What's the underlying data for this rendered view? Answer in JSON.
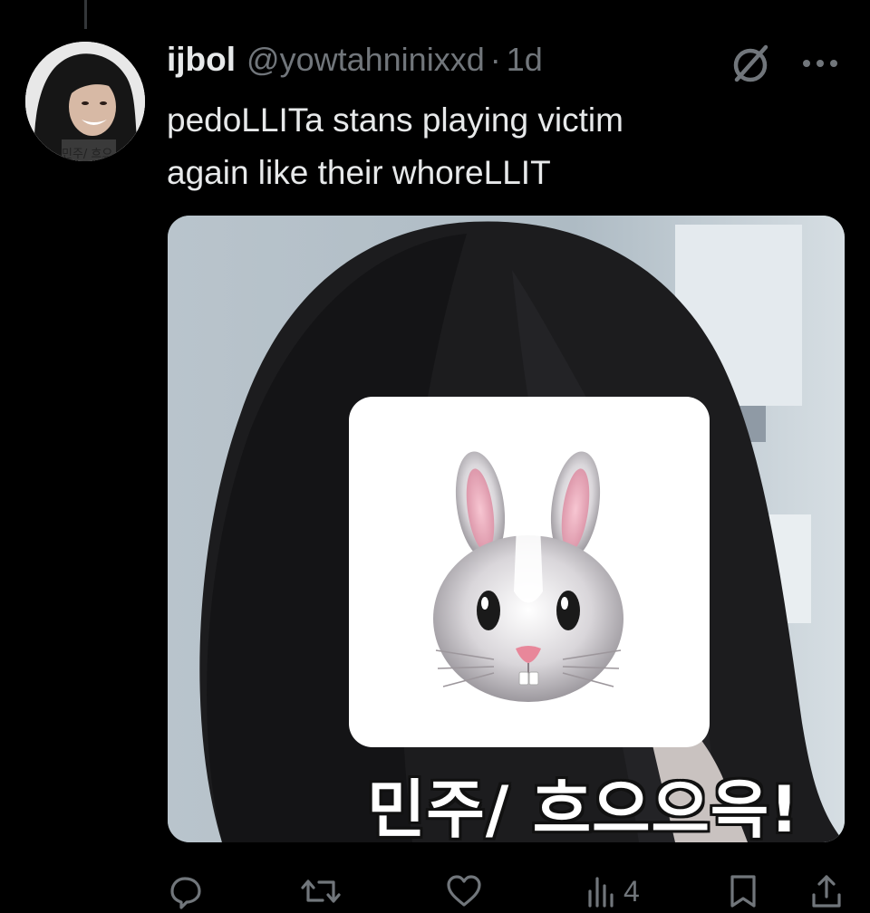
{
  "tweet": {
    "display_name": "ijbol",
    "handle": "@yowtahninixxd",
    "separator": "·",
    "time": "1d",
    "text_lines": [
      "pedoLLITa stans playing victim",
      "again like their whoreLLIT"
    ]
  },
  "avatar": {
    "caption": "민주/ 흐으"
  },
  "media": {
    "subtitle": "민주/ 흐으으윽!",
    "sticker_icon": "rabbit-face-icon"
  },
  "actions": {
    "reply_icon": "reply-icon",
    "repost_icon": "repost-icon",
    "like_icon": "like-icon",
    "views_icon": "views-icon",
    "views_count": "4",
    "bookmark_icon": "bookmark-icon",
    "share_icon": "share-icon"
  },
  "colors": {
    "background": "#000000",
    "text": "#e7e9ea",
    "muted": "#71767b"
  }
}
